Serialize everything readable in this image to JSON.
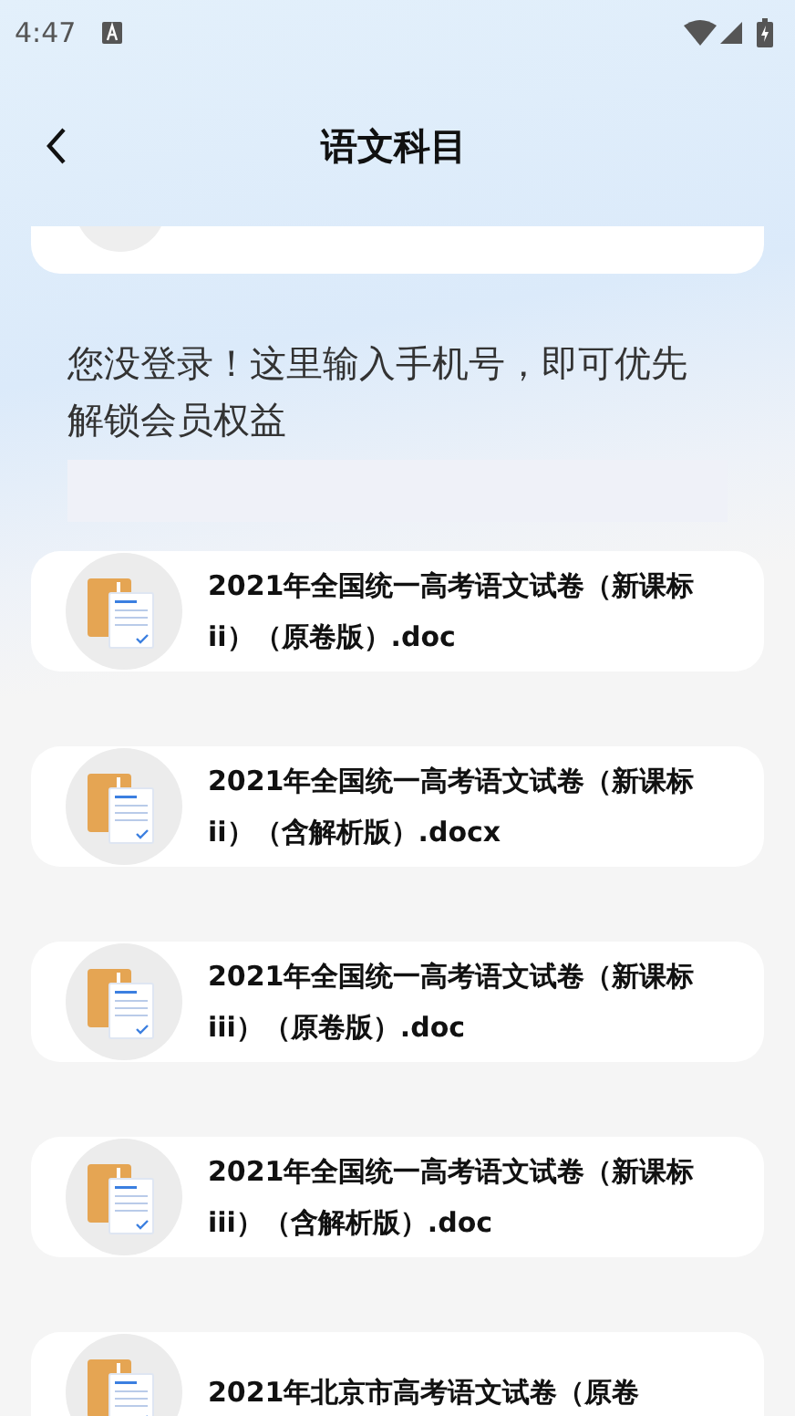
{
  "status_bar": {
    "time": "4:47"
  },
  "header": {
    "title": "语文科目"
  },
  "login_prompt": {
    "text": "您没登录！这里输入手机号，即可优先解锁会员权益"
  },
  "files": [
    {
      "name": "2021年全国统一高考语文试卷（新课标ii）（原卷版）.doc"
    },
    {
      "name": "2021年全国统一高考语文试卷（新课标ii）（含解析版）.docx"
    },
    {
      "name": "2021年全国统一高考语文试卷（新课标iii）（原卷版）.doc"
    },
    {
      "name": "2021年全国统一高考语文试卷（新课标iii）（含解析版）.doc"
    },
    {
      "name": "2021年北京市高考语文试卷（原卷"
    }
  ]
}
